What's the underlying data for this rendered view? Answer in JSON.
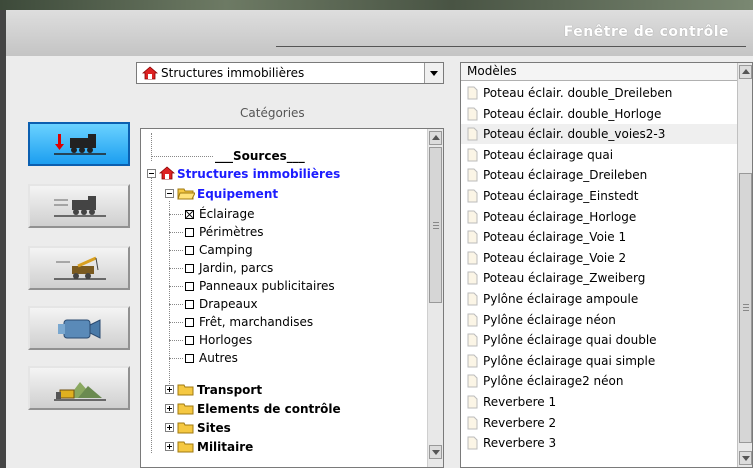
{
  "window": {
    "title": "Fenêtre de contrôle"
  },
  "category_combo": {
    "selected": "Structures immobilières"
  },
  "categories_label": "Catégories",
  "tree": {
    "sources": "___Sources___",
    "root": "Structures immobilières",
    "group": "Equipement",
    "items": [
      "Éclairage",
      "Périmètres",
      "Camping",
      "Jardin, parcs",
      "Panneaux publicitaires",
      "Drapeaux",
      "Frêt, marchandises",
      "Horloges",
      "Autres"
    ],
    "others": [
      "Transport",
      "Elements de contrôle",
      "Sites",
      "Militaire"
    ]
  },
  "models": {
    "header": "Modèles",
    "items": [
      "Poteau éclair. double_Dreileben",
      "Poteau éclair. double_Horloge",
      "Poteau éclair. double_voies2-3",
      "Poteau éclairage quai",
      "Poteau éclairage_Dreileben",
      "Poteau éclairage_Einstedt",
      "Poteau éclairage_Horloge",
      "Poteau éclairage_Voie 1",
      "Poteau éclairage_Voie 2",
      "Poteau éclairage_Zweiberg",
      "Pylône éclairage ampoule",
      "Pylône éclairage néon",
      "Pylône éclairage quai double",
      "Pylône éclairage quai simple",
      "Pylône éclairage2 néon",
      "Reverbere 1",
      "Reverbere 2",
      "Reverbere 3"
    ]
  }
}
